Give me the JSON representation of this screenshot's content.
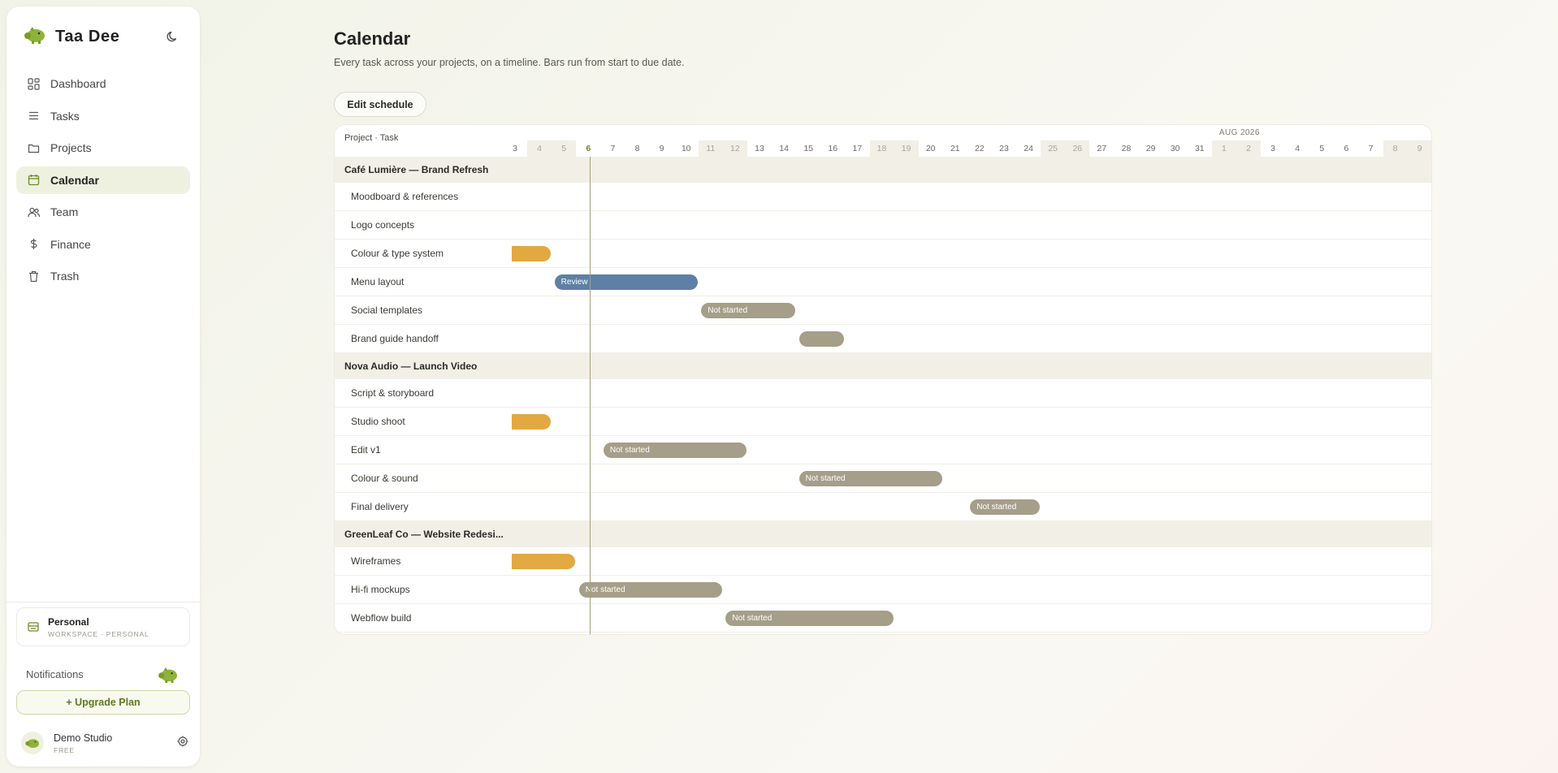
{
  "app": {
    "name": "Taa Dee"
  },
  "sidebar": {
    "items": [
      {
        "label": "Dashboard",
        "icon": "dashboard-icon",
        "active": false
      },
      {
        "label": "Tasks",
        "icon": "list-icon",
        "active": false
      },
      {
        "label": "Projects",
        "icon": "folder-icon",
        "active": false
      },
      {
        "label": "Calendar",
        "icon": "calendar-icon",
        "active": true
      },
      {
        "label": "Team",
        "icon": "users-icon",
        "active": false
      },
      {
        "label": "Finance",
        "icon": "dollar-icon",
        "active": false
      },
      {
        "label": "Trash",
        "icon": "trash-icon",
        "active": false
      }
    ],
    "workspace": {
      "title": "Personal",
      "subtitle": "WORKSPACE · PERSONAL"
    },
    "notifications_label": "Notifications",
    "upgrade_label": "+ Upgrade Plan",
    "user": {
      "name": "Demo Studio",
      "plan": "FREE"
    }
  },
  "page": {
    "title": "Calendar",
    "subtitle": "Every task across your projects, on a timeline. Bars run from start to due date.",
    "edit_button": "Edit schedule"
  },
  "colors": {
    "accent": "#6e8a24",
    "review": "#5e80a6",
    "not_started": "#a59e89",
    "in_progress": "#e2a842"
  },
  "gantt": {
    "header_label": "Project · Task",
    "month_label": "AUG 2026",
    "month_start_index": 29,
    "today_index": 3,
    "days": [
      {
        "d": "3",
        "w": false
      },
      {
        "d": "4",
        "w": true
      },
      {
        "d": "5",
        "w": true
      },
      {
        "d": "6",
        "w": false
      },
      {
        "d": "7",
        "w": false
      },
      {
        "d": "8",
        "w": false
      },
      {
        "d": "9",
        "w": false
      },
      {
        "d": "10",
        "w": false
      },
      {
        "d": "11",
        "w": true
      },
      {
        "d": "12",
        "w": true
      },
      {
        "d": "13",
        "w": false
      },
      {
        "d": "14",
        "w": false
      },
      {
        "d": "15",
        "w": false
      },
      {
        "d": "16",
        "w": false
      },
      {
        "d": "17",
        "w": false
      },
      {
        "d": "18",
        "w": true
      },
      {
        "d": "19",
        "w": true
      },
      {
        "d": "20",
        "w": false
      },
      {
        "d": "21",
        "w": false
      },
      {
        "d": "22",
        "w": false
      },
      {
        "d": "23",
        "w": false
      },
      {
        "d": "24",
        "w": false
      },
      {
        "d": "25",
        "w": true
      },
      {
        "d": "26",
        "w": true
      },
      {
        "d": "27",
        "w": false
      },
      {
        "d": "28",
        "w": false
      },
      {
        "d": "29",
        "w": false
      },
      {
        "d": "30",
        "w": false
      },
      {
        "d": "31",
        "w": false
      },
      {
        "d": "1",
        "w": true
      },
      {
        "d": "2",
        "w": true
      },
      {
        "d": "3",
        "w": false
      },
      {
        "d": "4",
        "w": false
      },
      {
        "d": "5",
        "w": false
      },
      {
        "d": "6",
        "w": false
      },
      {
        "d": "7",
        "w": false
      },
      {
        "d": "8",
        "w": true
      },
      {
        "d": "9",
        "w": true
      }
    ],
    "rows": [
      {
        "kind": "project",
        "label": "Café Lumière — Brand Refresh"
      },
      {
        "kind": "task",
        "label": "Moodboard & references"
      },
      {
        "kind": "task",
        "label": "Logo concepts"
      },
      {
        "kind": "task",
        "label": "Colour & type system",
        "bar": {
          "start": 0,
          "end": 1.6,
          "status": "in-progress",
          "text": "",
          "clip": true
        }
      },
      {
        "kind": "task",
        "label": "Menu layout",
        "bar": {
          "start": 1.75,
          "end": 7.6,
          "status": "review",
          "text": "Review"
        }
      },
      {
        "kind": "task",
        "label": "Social templates",
        "bar": {
          "start": 7.75,
          "end": 11.6,
          "status": "not-started",
          "text": "Not started"
        }
      },
      {
        "kind": "task",
        "label": "Brand guide handoff",
        "bar": {
          "start": 11.75,
          "end": 13.6,
          "status": "not-started",
          "text": ""
        }
      },
      {
        "kind": "project",
        "label": "Nova Audio — Launch Video"
      },
      {
        "kind": "task",
        "label": "Script & storyboard"
      },
      {
        "kind": "task",
        "label": "Studio shoot",
        "bar": {
          "start": 0,
          "end": 1.6,
          "status": "in-progress",
          "text": "",
          "clip": true
        }
      },
      {
        "kind": "task",
        "label": "Edit v1",
        "bar": {
          "start": 3.75,
          "end": 9.6,
          "status": "not-started",
          "text": "Not started"
        }
      },
      {
        "kind": "task",
        "label": "Colour & sound",
        "bar": {
          "start": 11.75,
          "end": 17.6,
          "status": "not-started",
          "text": "Not started"
        }
      },
      {
        "kind": "task",
        "label": "Final delivery",
        "bar": {
          "start": 18.75,
          "end": 21.6,
          "status": "not-started",
          "text": "Not started"
        }
      },
      {
        "kind": "project",
        "label": "GreenLeaf Co — Website Redesi..."
      },
      {
        "kind": "task",
        "label": "Wireframes",
        "bar": {
          "start": 0,
          "end": 2.6,
          "status": "in-progress",
          "text": "",
          "clip": true
        }
      },
      {
        "kind": "task",
        "label": "Hi-fi mockups",
        "bar": {
          "start": 2.75,
          "end": 8.6,
          "status": "not-started",
          "text": "Not started"
        }
      },
      {
        "kind": "task",
        "label": "Webflow build",
        "bar": {
          "start": 8.75,
          "end": 15.6,
          "status": "not-started",
          "text": "Not started"
        }
      }
    ]
  }
}
